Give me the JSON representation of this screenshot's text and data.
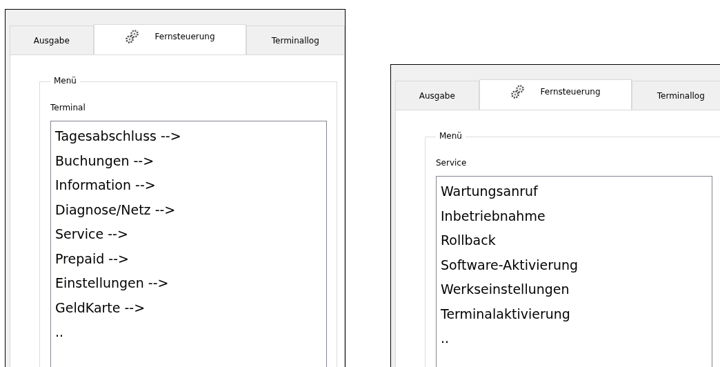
{
  "panels": [
    {
      "tabs": [
        {
          "label": "Ausgabe",
          "selected": false,
          "kind": "text"
        },
        {
          "label": "Fernsteuerung",
          "selected": true,
          "kind": "icon"
        },
        {
          "label": "Terminallog",
          "selected": false,
          "kind": "text"
        }
      ],
      "group_title": "Menü",
      "list_label": "Terminal",
      "items": [
        "Tagesabschluss -->",
        "Buchungen -->",
        "Information -->",
        "Diagnose/Netz -->",
        "Service -->",
        "Prepaid -->",
        "Einstellungen -->",
        "GeldKarte -->",
        ".."
      ]
    },
    {
      "tabs": [
        {
          "label": "Ausgabe",
          "selected": false,
          "kind": "text"
        },
        {
          "label": "Fernsteuerung",
          "selected": true,
          "kind": "icon"
        },
        {
          "label": "Terminallog",
          "selected": false,
          "kind": "text"
        }
      ],
      "group_title": "Menü",
      "list_label": "Service",
      "items": [
        "Wartungsanruf",
        "Inbetriebnahme",
        "Rollback",
        "Software-Aktivierung",
        "Werkseinstellungen",
        "Terminalaktivierung",
        ".."
      ]
    }
  ]
}
